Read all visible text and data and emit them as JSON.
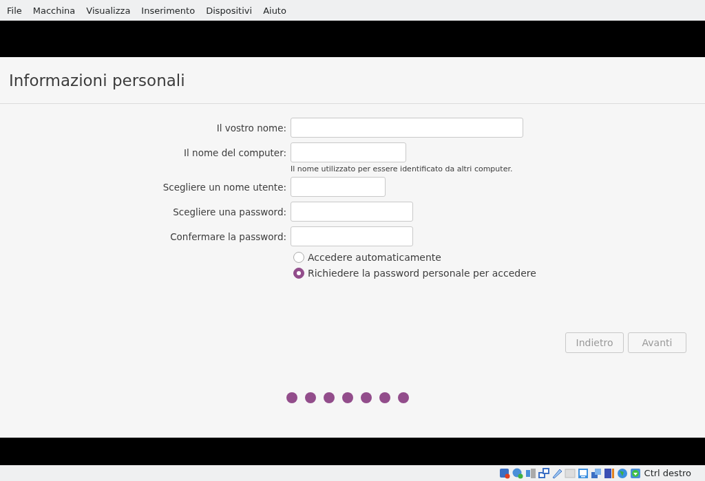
{
  "menu": [
    "File",
    "Macchina",
    "Visualizza",
    "Inserimento",
    "Dispositivi",
    "Aiuto"
  ],
  "title": "Informazioni personali",
  "fields": [
    {
      "label": "Il vostro nome:"
    },
    {
      "label": "Il nome del computer:",
      "hint": "Il nome utilizzato per essere identificato da altri computer."
    },
    {
      "label": "Scegliere un nome utente:"
    },
    {
      "label": "Scegliere una password:"
    },
    {
      "label": "Confermare la password:"
    }
  ],
  "login_options": [
    {
      "label": "Accedere automaticamente",
      "selected": false
    },
    {
      "label": "Richiedere la password personale per accedere",
      "selected": true
    }
  ],
  "buttons": [
    {
      "label": "Indietro",
      "disabled": true
    },
    {
      "label": "Avanti",
      "disabled": true
    }
  ],
  "progress_dots": [
    {
      "active": true
    },
    {
      "active": true
    },
    {
      "active": true
    },
    {
      "active": true
    },
    {
      "active": true
    },
    {
      "active": true
    },
    {
      "active": true
    }
  ],
  "status_bar": {
    "host_key": "Ctrl destro"
  }
}
